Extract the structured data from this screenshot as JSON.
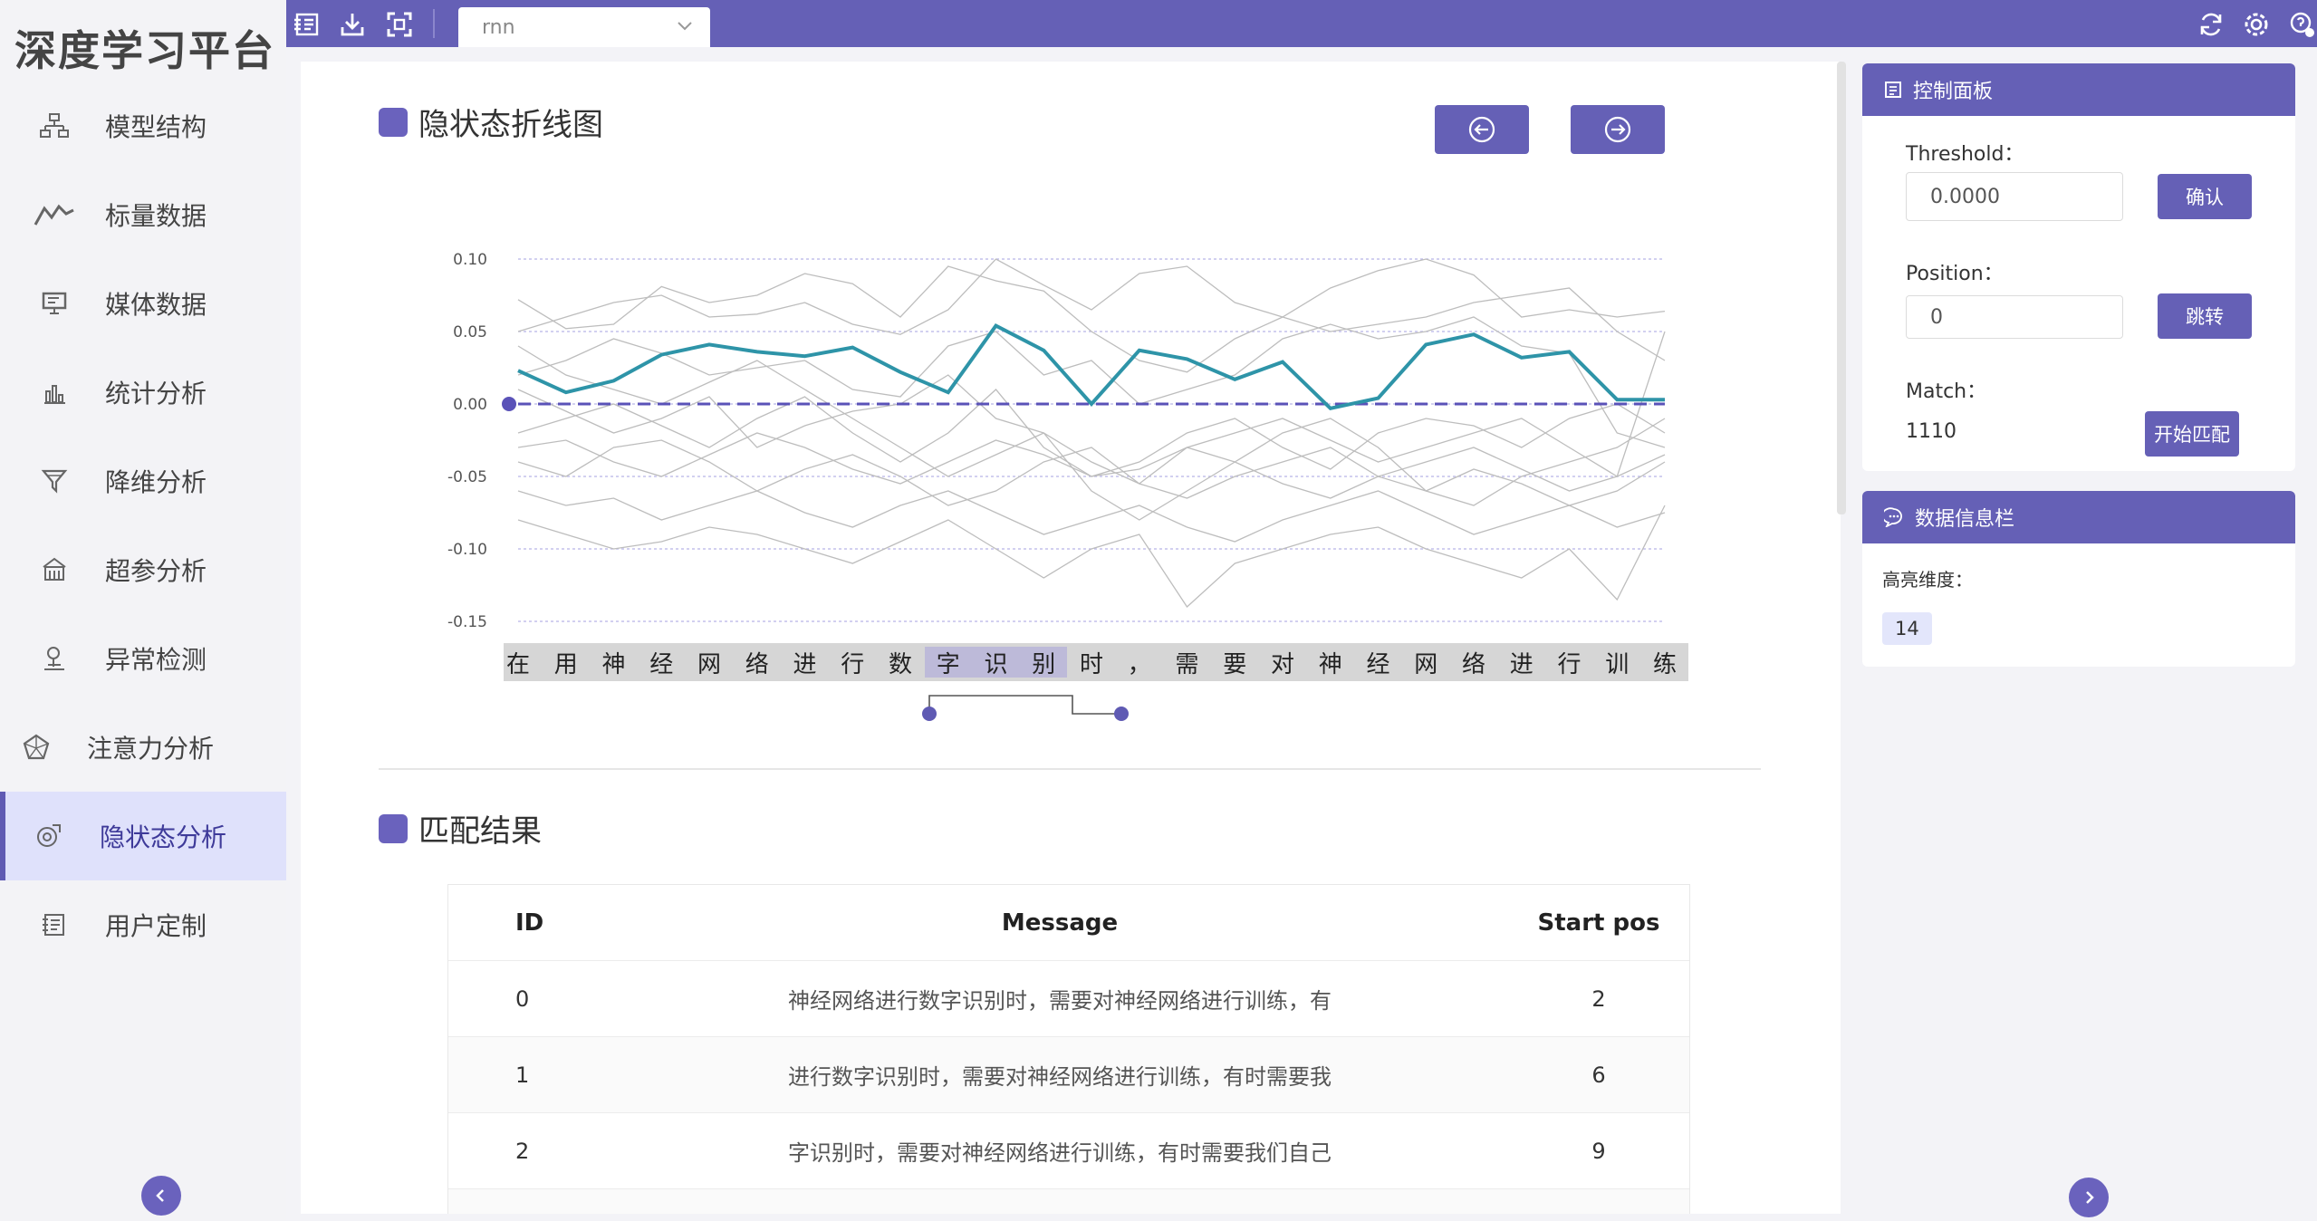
{
  "app": {
    "title": "深度学习平台"
  },
  "sidebar": {
    "items": [
      {
        "label": "模型结构",
        "icon": "network-structure-icon",
        "active": false
      },
      {
        "label": "标量数据",
        "icon": "line-trend-icon",
        "active": false
      },
      {
        "label": "媒体数据",
        "icon": "monitor-icon",
        "active": false
      },
      {
        "label": "统计分析",
        "icon": "bar-chart-icon",
        "active": false
      },
      {
        "label": "降维分析",
        "icon": "funnel-icon",
        "active": false
      },
      {
        "label": "超参分析",
        "icon": "building-icon",
        "active": false
      },
      {
        "label": "异常检测",
        "icon": "pin-alert-icon",
        "active": false
      },
      {
        "label": "注意力分析",
        "icon": "pentagon-icon",
        "active": false
      },
      {
        "label": "隐状态分析",
        "icon": "hidden-state-icon",
        "active": true
      },
      {
        "label": "用户定制",
        "icon": "custom-icon",
        "active": false
      }
    ],
    "collapse_icon": "chevron-left-icon"
  },
  "toolbar": {
    "icons": [
      "import-icon",
      "download-icon",
      "fullscreen-icon",
      "refresh-icon",
      "settings-icon",
      "help-icon"
    ],
    "model_select": {
      "value": "rnn"
    }
  },
  "chart_section": {
    "title": "隐状态折线图",
    "prev_icon": "arrow-left-circle-icon",
    "next_icon": "arrow-right-circle-icon"
  },
  "chart_data": {
    "type": "line",
    "ylim": [
      -0.15,
      0.1
    ],
    "yticks": [
      "0.10",
      "0.05",
      "0.00",
      "-0.05",
      "-0.10",
      "-0.15"
    ],
    "categories": [
      "在",
      "用",
      "神",
      "经",
      "网",
      "络",
      "进",
      "行",
      "数",
      "字",
      "识",
      "别",
      "时",
      "，",
      "需",
      "要",
      "对",
      "神",
      "经",
      "网",
      "络",
      "进",
      "行",
      "训",
      "练"
    ],
    "highlight_range": [
      9,
      11
    ],
    "threshold": 0.0,
    "highlighted_series": {
      "color": "#2e94a8",
      "values": [
        0.023,
        0.008,
        0.016,
        0.034,
        0.041,
        0.036,
        0.033,
        0.039,
        0.022,
        0.008,
        0.054,
        0.037,
        0.0,
        0.037,
        0.031,
        0.017,
        0.029,
        -0.003,
        0.004,
        0.041,
        0.048,
        0.032,
        0.036,
        0.003,
        0.003
      ]
    },
    "background_series_color": "#bdbdbd",
    "background_series": [
      [
        0.072,
        0.052,
        0.055,
        0.081,
        0.07,
        0.075,
        0.09,
        0.083,
        0.06,
        0.095,
        0.085,
        0.078,
        0.05,
        0.03,
        0.022,
        0.045,
        0.06,
        0.08,
        0.092,
        0.1,
        0.089,
        0.06,
        0.065,
        0.06,
        0.064
      ],
      [
        0.05,
        0.06,
        0.07,
        0.075,
        0.06,
        0.062,
        0.07,
        0.055,
        0.048,
        0.065,
        0.1,
        0.082,
        0.065,
        0.09,
        0.095,
        0.07,
        0.06,
        0.05,
        0.055,
        0.06,
        0.07,
        0.075,
        0.08,
        0.05,
        0.03
      ],
      [
        0.02,
        0.03,
        0.045,
        0.035,
        0.02,
        0.025,
        0.03,
        0.01,
        0.005,
        0.04,
        0.05,
        0.02,
        0.03,
        0.0,
        0.01,
        0.02,
        0.045,
        0.055,
        0.045,
        0.05,
        0.06,
        0.04,
        0.035,
        -0.02,
        -0.03
      ],
      [
        -0.02,
        -0.01,
        0.0,
        -0.015,
        -0.03,
        -0.01,
        0.005,
        -0.02,
        -0.04,
        -0.02,
        0.01,
        -0.03,
        -0.05,
        -0.04,
        -0.02,
        -0.01,
        -0.03,
        -0.045,
        -0.02,
        -0.01,
        -0.015,
        -0.03,
        -0.01,
        0.0,
        -0.02
      ],
      [
        -0.04,
        -0.05,
        -0.03,
        -0.025,
        -0.04,
        -0.06,
        -0.045,
        -0.035,
        -0.05,
        -0.07,
        -0.06,
        -0.04,
        -0.03,
        -0.055,
        -0.065,
        -0.05,
        -0.04,
        -0.03,
        -0.05,
        -0.06,
        -0.045,
        -0.055,
        -0.07,
        -0.06,
        -0.04
      ],
      [
        -0.06,
        -0.07,
        -0.065,
        -0.08,
        -0.07,
        -0.06,
        -0.075,
        -0.085,
        -0.07,
        -0.06,
        -0.075,
        -0.09,
        -0.08,
        -0.07,
        -0.085,
        -0.095,
        -0.08,
        -0.07,
        -0.06,
        -0.075,
        -0.09,
        -0.08,
        -0.07,
        -0.085,
        -0.075
      ],
      [
        -0.08,
        -0.09,
        -0.1,
        -0.095,
        -0.085,
        -0.09,
        -0.1,
        -0.11,
        -0.095,
        -0.08,
        -0.1,
        -0.12,
        -0.1,
        -0.09,
        -0.14,
        -0.11,
        -0.1,
        -0.09,
        -0.085,
        -0.1,
        -0.11,
        -0.12,
        -0.1,
        -0.135,
        -0.07
      ],
      [
        0.01,
        -0.005,
        -0.02,
        -0.01,
        0.005,
        -0.03,
        -0.015,
        -0.005,
        0.0,
        0.02,
        -0.01,
        -0.02,
        -0.04,
        -0.055,
        -0.03,
        -0.02,
        -0.01,
        -0.025,
        -0.04,
        -0.03,
        -0.02,
        -0.01,
        -0.03,
        -0.05,
        0.05
      ],
      [
        0.04,
        0.02,
        0.01,
        0.0,
        0.015,
        0.03,
        0.01,
        -0.01,
        -0.03,
        -0.05,
        -0.035,
        -0.02,
        -0.06,
        -0.08,
        -0.06,
        -0.04,
        -0.02,
        -0.01,
        -0.03,
        -0.06,
        -0.07,
        -0.05,
        -0.04,
        -0.03,
        -0.01
      ],
      [
        -0.03,
        -0.025,
        -0.04,
        -0.05,
        -0.035,
        -0.02,
        -0.03,
        -0.045,
        -0.055,
        -0.04,
        -0.025,
        -0.035,
        -0.05,
        -0.045,
        -0.03,
        -0.04,
        -0.055,
        -0.065,
        -0.05,
        -0.04,
        -0.03,
        -0.045,
        -0.06,
        -0.05,
        -0.035
      ]
    ]
  },
  "token_connector": {
    "icon": "range-slider-handle-icon"
  },
  "results": {
    "title": "匹配结果",
    "columns": [
      "ID",
      "Message",
      "Start pos"
    ],
    "rows": [
      {
        "id": "0",
        "message": "神经网络进行数字识别时，需要对神经网络进行训练，有",
        "start": "2"
      },
      {
        "id": "1",
        "message": "进行数字识别时，需要对神经网络进行训练，有时需要我",
        "start": "6"
      },
      {
        "id": "2",
        "message": "字识别时，需要对神经网络进行训练，有时需要我们自己",
        "start": "9"
      }
    ]
  },
  "control_panel": {
    "title": "控制面板",
    "icon": "panel-icon",
    "threshold_label": "Threshold：",
    "threshold_value": "0.0000",
    "confirm_label": "确认",
    "position_label": "Position：",
    "position_value": "0",
    "jump_label": "跳转",
    "match_label": "Match：",
    "match_value": "1110",
    "start_match_label": "开始匹配"
  },
  "info_panel": {
    "title": "数据信息栏",
    "icon": "chat-icon",
    "highlight_label": "高亮维度：",
    "highlight_value": "14"
  },
  "right_collapse_icon": "chevron-right-icon"
}
